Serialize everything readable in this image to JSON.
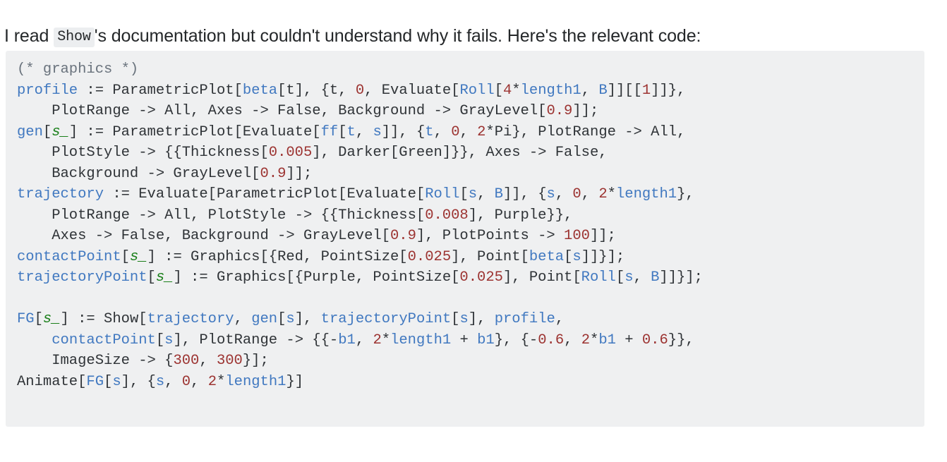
{
  "post": {
    "intro": {
      "before": "I read ",
      "inline_code": "Show",
      "after": "'s documentation but couldn't understand why it fails. Here's the relevant code:"
    }
  },
  "colors": {
    "code_background": "#eff0f1",
    "inline_code_background": "#eceef0",
    "text": "#242729",
    "identifier": "#4078c0",
    "number": "#9c3331",
    "pattern": "#1a7f1a",
    "comment": "#6a737d",
    "plain_code": "#2f3337"
  },
  "code_block": {
    "language": "mathematica",
    "lines": [
      [
        {
          "t": "(* graphics *)",
          "c": "comment"
        }
      ],
      [
        {
          "t": "profile",
          "c": "ident"
        },
        {
          "t": " := ParametricPlot[",
          "c": "plain"
        },
        {
          "t": "beta",
          "c": "ident"
        },
        {
          "t": "[t], {t, ",
          "c": "plain"
        },
        {
          "t": "0",
          "c": "num"
        },
        {
          "t": ", Evaluate[",
          "c": "plain"
        },
        {
          "t": "Roll",
          "c": "ident"
        },
        {
          "t": "[",
          "c": "plain"
        },
        {
          "t": "4",
          "c": "num"
        },
        {
          "t": "*",
          "c": "plain"
        },
        {
          "t": "length1",
          "c": "ident"
        },
        {
          "t": ", ",
          "c": "plain"
        },
        {
          "t": "B",
          "c": "ident"
        },
        {
          "t": "]][[",
          "c": "plain"
        },
        {
          "t": "1",
          "c": "num"
        },
        {
          "t": "]]},",
          "c": "plain"
        }
      ],
      [
        {
          "t": "    PlotRange -> All, Axes -> False, Background -> GrayLevel[",
          "c": "plain"
        },
        {
          "t": "0.9",
          "c": "num"
        },
        {
          "t": "]];",
          "c": "plain"
        }
      ],
      [
        {
          "t": "gen",
          "c": "ident"
        },
        {
          "t": "[",
          "c": "plain"
        },
        {
          "t": "s_",
          "c": "pattern"
        },
        {
          "t": "] := ParametricPlot[Evaluate[",
          "c": "plain"
        },
        {
          "t": "ff",
          "c": "ident"
        },
        {
          "t": "[",
          "c": "plain"
        },
        {
          "t": "t",
          "c": "ident"
        },
        {
          "t": ", ",
          "c": "plain"
        },
        {
          "t": "s",
          "c": "ident"
        },
        {
          "t": "]], {",
          "c": "plain"
        },
        {
          "t": "t",
          "c": "ident"
        },
        {
          "t": ", ",
          "c": "plain"
        },
        {
          "t": "0",
          "c": "num"
        },
        {
          "t": ", ",
          "c": "plain"
        },
        {
          "t": "2",
          "c": "num"
        },
        {
          "t": "*Pi}, PlotRange -> All,",
          "c": "plain"
        }
      ],
      [
        {
          "t": "    PlotStyle -> {{Thickness[",
          "c": "plain"
        },
        {
          "t": "0.005",
          "c": "num"
        },
        {
          "t": "], Darker[Green]}}, Axes -> False,",
          "c": "plain"
        }
      ],
      [
        {
          "t": "    Background -> GrayLevel[",
          "c": "plain"
        },
        {
          "t": "0.9",
          "c": "num"
        },
        {
          "t": "]];",
          "c": "plain"
        }
      ],
      [
        {
          "t": "trajectory",
          "c": "ident"
        },
        {
          "t": " := Evaluate[ParametricPlot[Evaluate[",
          "c": "plain"
        },
        {
          "t": "Roll",
          "c": "ident"
        },
        {
          "t": "[",
          "c": "plain"
        },
        {
          "t": "s",
          "c": "ident"
        },
        {
          "t": ", ",
          "c": "plain"
        },
        {
          "t": "B",
          "c": "ident"
        },
        {
          "t": "]], {",
          "c": "plain"
        },
        {
          "t": "s",
          "c": "ident"
        },
        {
          "t": ", ",
          "c": "plain"
        },
        {
          "t": "0",
          "c": "num"
        },
        {
          "t": ", ",
          "c": "plain"
        },
        {
          "t": "2",
          "c": "num"
        },
        {
          "t": "*",
          "c": "plain"
        },
        {
          "t": "length1",
          "c": "ident"
        },
        {
          "t": "},",
          "c": "plain"
        }
      ],
      [
        {
          "t": "    PlotRange -> All, PlotStyle -> {{Thickness[",
          "c": "plain"
        },
        {
          "t": "0.008",
          "c": "num"
        },
        {
          "t": "], Purple}},",
          "c": "plain"
        }
      ],
      [
        {
          "t": "    Axes -> False, Background -> GrayLevel[",
          "c": "plain"
        },
        {
          "t": "0.9",
          "c": "num"
        },
        {
          "t": "], PlotPoints -> ",
          "c": "plain"
        },
        {
          "t": "100",
          "c": "num"
        },
        {
          "t": "]];",
          "c": "plain"
        }
      ],
      [
        {
          "t": "contactPoint",
          "c": "ident"
        },
        {
          "t": "[",
          "c": "plain"
        },
        {
          "t": "s_",
          "c": "pattern"
        },
        {
          "t": "] := Graphics[{Red, PointSize[",
          "c": "plain"
        },
        {
          "t": "0.025",
          "c": "num"
        },
        {
          "t": "], Point[",
          "c": "plain"
        },
        {
          "t": "beta",
          "c": "ident"
        },
        {
          "t": "[",
          "c": "plain"
        },
        {
          "t": "s",
          "c": "ident"
        },
        {
          "t": "]]}];",
          "c": "plain"
        }
      ],
      [
        {
          "t": "trajectoryPoint",
          "c": "ident"
        },
        {
          "t": "[",
          "c": "plain"
        },
        {
          "t": "s_",
          "c": "pattern"
        },
        {
          "t": "] := Graphics[{Purple, PointSize[",
          "c": "plain"
        },
        {
          "t": "0.025",
          "c": "num"
        },
        {
          "t": "], Point[",
          "c": "plain"
        },
        {
          "t": "Roll",
          "c": "ident"
        },
        {
          "t": "[",
          "c": "plain"
        },
        {
          "t": "s",
          "c": "ident"
        },
        {
          "t": ", ",
          "c": "plain"
        },
        {
          "t": "B",
          "c": "ident"
        },
        {
          "t": "]]}];",
          "c": "plain"
        }
      ],
      [
        {
          "t": "",
          "c": "plain"
        }
      ],
      [
        {
          "t": "FG",
          "c": "ident"
        },
        {
          "t": "[",
          "c": "plain"
        },
        {
          "t": "s_",
          "c": "pattern"
        },
        {
          "t": "] := Show[",
          "c": "plain"
        },
        {
          "t": "trajectory",
          "c": "ident"
        },
        {
          "t": ", ",
          "c": "plain"
        },
        {
          "t": "gen",
          "c": "ident"
        },
        {
          "t": "[",
          "c": "plain"
        },
        {
          "t": "s",
          "c": "ident"
        },
        {
          "t": "], ",
          "c": "plain"
        },
        {
          "t": "trajectoryPoint",
          "c": "ident"
        },
        {
          "t": "[",
          "c": "plain"
        },
        {
          "t": "s",
          "c": "ident"
        },
        {
          "t": "], ",
          "c": "plain"
        },
        {
          "t": "profile",
          "c": "ident"
        },
        {
          "t": ",",
          "c": "plain"
        }
      ],
      [
        {
          "t": "    ",
          "c": "plain"
        },
        {
          "t": "contactPoint",
          "c": "ident"
        },
        {
          "t": "[",
          "c": "plain"
        },
        {
          "t": "s",
          "c": "ident"
        },
        {
          "t": "], PlotRange -> {{-",
          "c": "plain"
        },
        {
          "t": "b1",
          "c": "ident"
        },
        {
          "t": ", ",
          "c": "plain"
        },
        {
          "t": "2",
          "c": "num"
        },
        {
          "t": "*",
          "c": "plain"
        },
        {
          "t": "length1",
          "c": "ident"
        },
        {
          "t": " + ",
          "c": "plain"
        },
        {
          "t": "b1",
          "c": "ident"
        },
        {
          "t": "}, {-",
          "c": "plain"
        },
        {
          "t": "0.6",
          "c": "num"
        },
        {
          "t": ", ",
          "c": "plain"
        },
        {
          "t": "2",
          "c": "num"
        },
        {
          "t": "*",
          "c": "plain"
        },
        {
          "t": "b1",
          "c": "ident"
        },
        {
          "t": " + ",
          "c": "plain"
        },
        {
          "t": "0.6",
          "c": "num"
        },
        {
          "t": "}},",
          "c": "plain"
        }
      ],
      [
        {
          "t": "    ImageSize -> {",
          "c": "plain"
        },
        {
          "t": "300",
          "c": "num"
        },
        {
          "t": ", ",
          "c": "plain"
        },
        {
          "t": "300",
          "c": "num"
        },
        {
          "t": "}];",
          "c": "plain"
        }
      ],
      [
        {
          "t": "Animate[",
          "c": "plain"
        },
        {
          "t": "FG",
          "c": "ident"
        },
        {
          "t": "[",
          "c": "plain"
        },
        {
          "t": "s",
          "c": "ident"
        },
        {
          "t": "], {",
          "c": "plain"
        },
        {
          "t": "s",
          "c": "ident"
        },
        {
          "t": ", ",
          "c": "plain"
        },
        {
          "t": "0",
          "c": "num"
        },
        {
          "t": ", ",
          "c": "plain"
        },
        {
          "t": "2",
          "c": "num"
        },
        {
          "t": "*",
          "c": "plain"
        },
        {
          "t": "length1",
          "c": "ident"
        },
        {
          "t": "}]",
          "c": "plain"
        }
      ]
    ]
  }
}
